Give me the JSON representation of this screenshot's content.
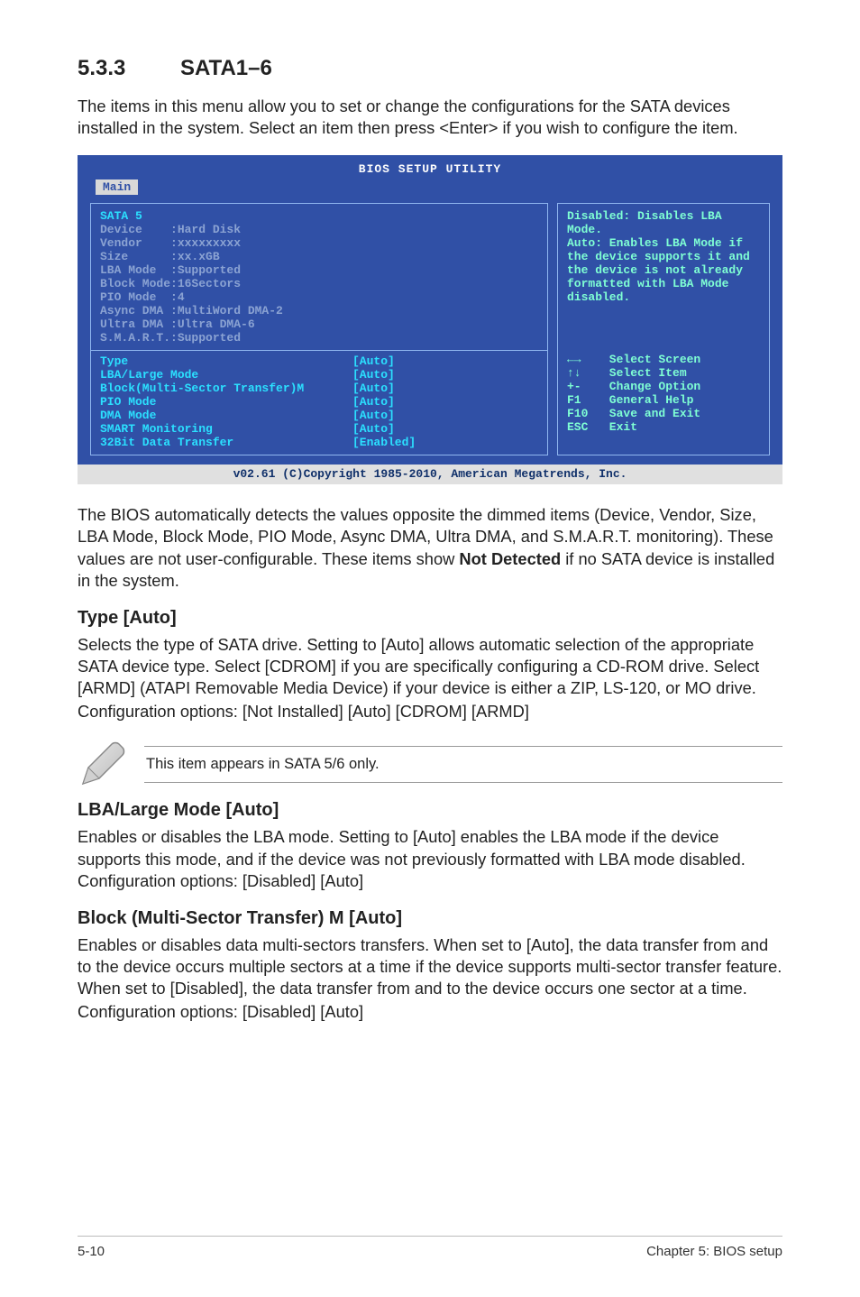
{
  "section": {
    "number": "5.3.3",
    "title": "SATA1–6"
  },
  "intro": "The items in this menu allow you to set or change the configurations for the SATA devices installed in the system. Select an item then press <Enter> if you wish to configure the item.",
  "bios": {
    "title": "BIOS SETUP UTILITY",
    "tab": "Main",
    "left_header": "SATA 5",
    "info": [
      "Device    :Hard Disk",
      "Vendor    :xxxxxxxxx",
      "Size      :xx.xGB",
      "LBA Mode  :Supported",
      "Block Mode:16Sectors",
      "PIO Mode  :4",
      "Async DMA :MultiWord DMA-2",
      "Ultra DMA :Ultra DMA-6",
      "S.M.A.R.T.:Supported"
    ],
    "options": [
      {
        "label": "Type",
        "value": "[Auto]"
      },
      {
        "label": "LBA/Large Mode",
        "value": "[Auto]"
      },
      {
        "label": "Block(Multi-Sector Transfer)M",
        "value": "[Auto]"
      },
      {
        "label": "PIO Mode",
        "value": "[Auto]"
      },
      {
        "label": "DMA Mode",
        "value": "[Auto]"
      },
      {
        "label": "SMART Monitoring",
        "value": "[Auto]"
      },
      {
        "label": "32Bit Data Transfer",
        "value": "[Enabled]"
      }
    ],
    "help_top": "Disabled: Disables LBA Mode.\nAuto: Enables LBA Mode if the device supports it and the device is not already formatted with LBA Mode disabled.",
    "nav": [
      "←→    Select Screen",
      "↑↓    Select Item",
      "+-    Change Option",
      "F1    General Help",
      "F10   Save and Exit",
      "ESC   Exit"
    ],
    "footer": "v02.61 (C)Copyright 1985-2010, American Megatrends, Inc."
  },
  "post_bios": "The BIOS automatically detects the values opposite the dimmed items (Device, Vendor, Size, LBA Mode, Block Mode, PIO Mode, Async DMA, Ultra DMA, and S.M.A.R.T. monitoring). These values are not user-configurable. These items show ",
  "post_bios_bold": "Not Detected",
  "post_bios_tail": " if no SATA device is installed in the system.",
  "type": {
    "heading": "Type [Auto]",
    "body": "Selects the type of SATA drive. Setting to [Auto] allows automatic selection of the appropriate SATA device type. Select [CDROM] if you are specifically configuring a CD-ROM drive. Select [ARMD] (ATAPI Removable Media Device) if your device is either a ZIP, LS-120, or MO drive.",
    "config": "Configuration options: [Not Installed] [Auto] [CDROM] [ARMD]"
  },
  "note": "This item appears in SATA 5/6 only.",
  "lba": {
    "heading": "LBA/Large Mode [Auto]",
    "body": "Enables or disables the LBA mode. Setting to [Auto] enables the LBA mode if the device supports this mode, and if the device was not previously formatted with LBA mode disabled. Configuration options: [Disabled] [Auto]"
  },
  "block": {
    "heading": "Block (Multi-Sector Transfer) M [Auto]",
    "body": "Enables or disables data multi-sectors transfers. When set to [Auto], the data transfer from and to the device occurs multiple sectors at a time if the device supports multi-sector transfer feature. When set to [Disabled], the data transfer from and to the device occurs one sector at a time.",
    "config": "Configuration options: [Disabled] [Auto]"
  },
  "footer": {
    "left": "5-10",
    "right": "Chapter 5: BIOS setup"
  }
}
